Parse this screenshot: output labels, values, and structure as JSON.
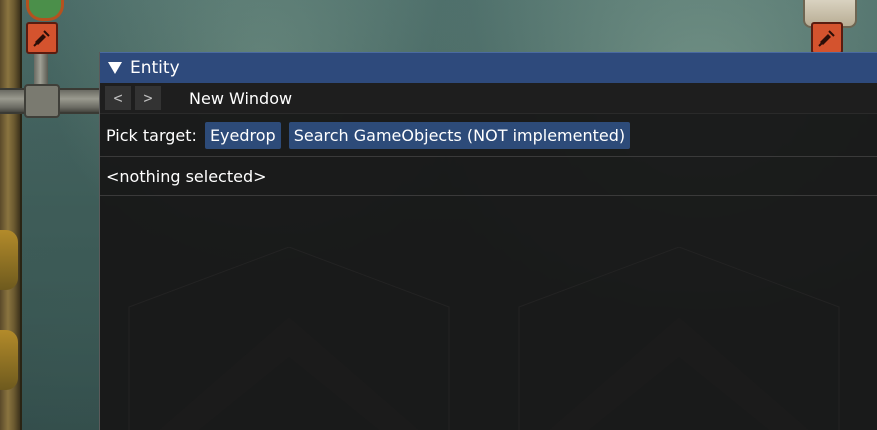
{
  "window": {
    "title": "Entity",
    "nav_back": "<",
    "nav_forward": ">",
    "tab_title": "New Window",
    "pick_label": "Pick target:",
    "eyedrop_button": "Eyedrop",
    "search_button": "Search GameObjects (NOT implemented)",
    "selection_text": "<nothing selected>"
  },
  "icons": [
    "collapse-arrow-icon",
    "warning-tile-icon"
  ],
  "colors": {
    "titlebar": "#2e4a7c",
    "button": "#2d4b79",
    "window_bg": "#181818"
  }
}
